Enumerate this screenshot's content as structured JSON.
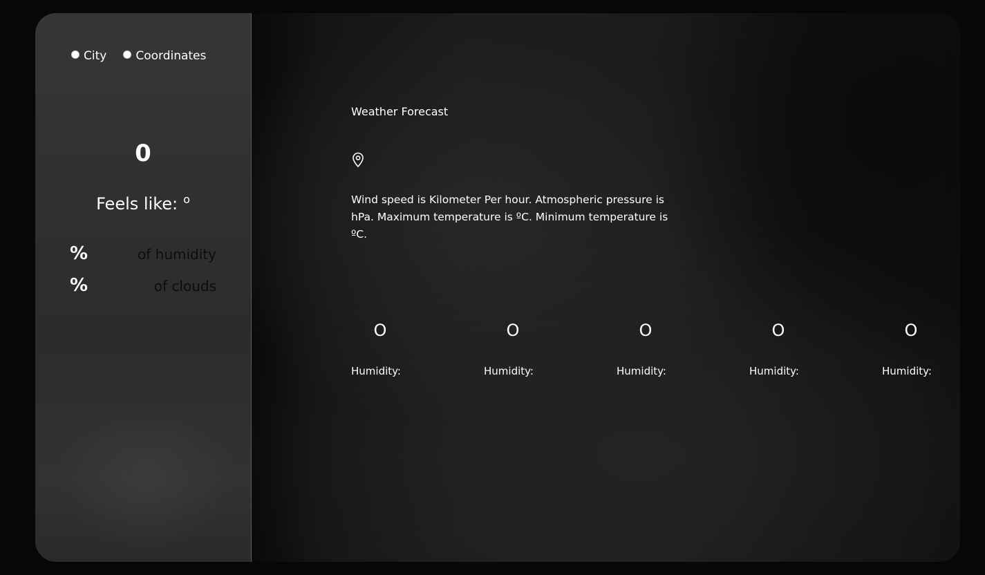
{
  "sidebar": {
    "search_mode": {
      "options": [
        "City",
        "Coordinates"
      ]
    },
    "current_temp": "0",
    "feels_like_label": "Feels like:",
    "feels_like_unit": "o",
    "stats": [
      {
        "value": "%",
        "label": "of humidity"
      },
      {
        "value": "%",
        "label": "of clouds"
      }
    ]
  },
  "main": {
    "title": "Weather Forecast",
    "location_icon": "map-pin-icon",
    "description": "Wind speed is Kilometer Per hour. Atmospheric pressure is hPa. Maximum temperature is ºC. Minimum temperature is ºC.",
    "forecast": [
      {
        "temp": "O",
        "humidity_label": "Humidity:"
      },
      {
        "temp": "O",
        "humidity_label": "Humidity:"
      },
      {
        "temp": "O",
        "humidity_label": "Humidity:"
      },
      {
        "temp": "O",
        "humidity_label": "Humidity:"
      },
      {
        "temp": "O",
        "humidity_label": "Humidity:"
      }
    ]
  },
  "colors": {
    "page_background": "#070707",
    "sidebar_background": "#333333",
    "main_background": "#1b1b1b",
    "text": "#ffffff",
    "stat_label_text": "#0d0d0d"
  }
}
